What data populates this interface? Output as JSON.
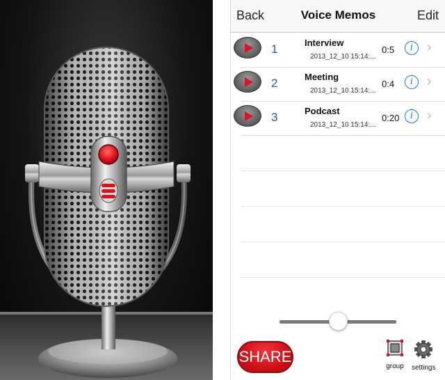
{
  "nav": {
    "back_label": "Back",
    "title": "Voice Memos",
    "edit_label": "Edit"
  },
  "memos": [
    {
      "number": "1",
      "name": "Interview",
      "date": "2013_12_10 15:14:...",
      "duration": "0:5"
    },
    {
      "number": "2",
      "name": "Meeting",
      "date": "2013_12_10 15:14:...",
      "duration": "0:4"
    },
    {
      "number": "3",
      "name": "Podcast",
      "date": "2013_12_10 15:14:...",
      "duration": "0:20"
    }
  ],
  "icons": {
    "play": "play-icon",
    "info": "info-icon",
    "chevron": "chevron-right-icon",
    "group": "group-icon",
    "settings": "gear-icon"
  },
  "glyphs": {
    "info": "i",
    "chevron": "›"
  },
  "playback": {
    "position": 0.5
  },
  "toolbar": {
    "share_label": "SHARE",
    "group_label": "group",
    "settings_label": "settings"
  },
  "colors": {
    "accent_red": "#e0122a",
    "info_blue": "#1a7ae8",
    "number_blue": "#2f57a8"
  }
}
